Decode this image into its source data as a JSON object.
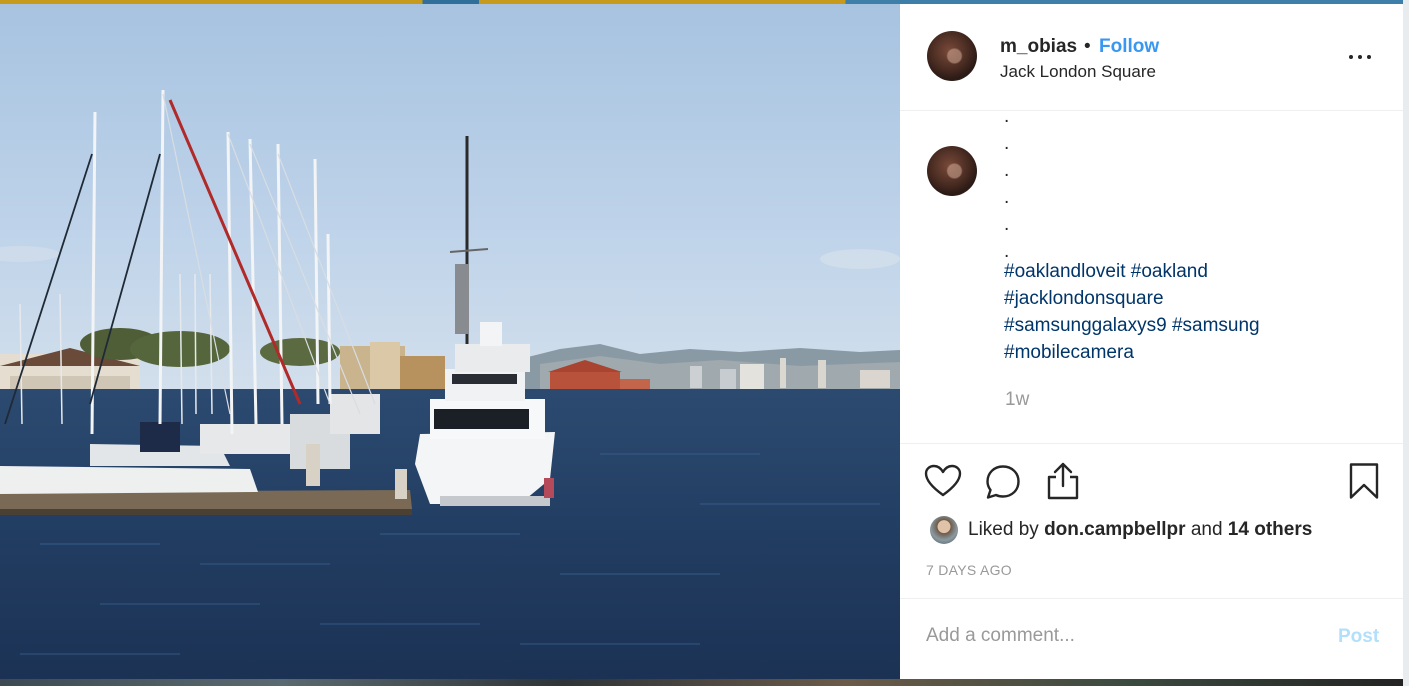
{
  "post": {
    "username": "m_obias",
    "separator": "•",
    "follow_label": "Follow",
    "location": "Jack London Square"
  },
  "caption": {
    "dot_lines": [
      ".",
      ".",
      ".",
      ".",
      ".",
      "."
    ],
    "hashtags": [
      "#oaklandloveit",
      "#oakland",
      "#jacklondonsquare",
      "#samsunggalaxys9",
      "#samsung",
      "#mobilecamera"
    ],
    "time_ago": "1w"
  },
  "likes": {
    "prefix": "Liked by",
    "user": "don.campbellpr",
    "joiner": "and",
    "others": "14 others"
  },
  "date": "7 DAYS AGO",
  "comment": {
    "placeholder": "Add a comment...",
    "post_label": "Post"
  },
  "icons": {
    "like": "heart-icon",
    "comment": "comment-bubble-icon",
    "share": "share-icon",
    "save": "bookmark-icon",
    "more": "more-options-icon"
  },
  "colors": {
    "link_blue": "#3897f0",
    "hashtag_navy": "#003569",
    "muted_gray": "#999999",
    "post_disabled": "#b2dffc",
    "text_dark": "#262626"
  }
}
